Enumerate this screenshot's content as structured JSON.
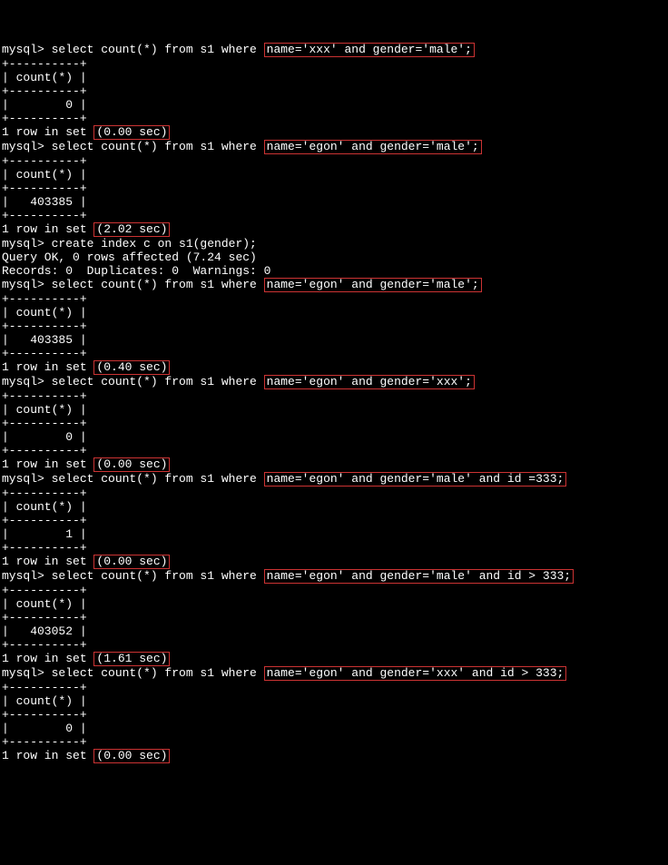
{
  "prompt": "mysql> ",
  "sep": "+----------+",
  "hdr": "| count(*) |",
  "rowfmt": "1 row in set ",
  "q1": {
    "pre": "select count(*) from s1 where ",
    "cond": "name='xxx' and gender='male';",
    "val": "|        0 |",
    "time": "(0.00 sec)"
  },
  "q2": {
    "pre": "select count(*) from s1 where ",
    "cond": "name='egon' and gender='male';",
    "val": "|   403385 |",
    "time": "(2.02 sec)"
  },
  "idx": {
    "cmd": "create index c on s1(gender);",
    "ok": "Query OK, 0 rows affected (7.24 sec)",
    "rec": "Records: 0  Duplicates: 0  Warnings: 0"
  },
  "q3": {
    "pre": "select count(*) from s1 where ",
    "cond": "name='egon' and gender='male';",
    "val": "|   403385 |",
    "time": "(0.40 sec)"
  },
  "q4": {
    "pre": "select count(*) from s1 where ",
    "cond": "name='egon' and gender='xxx';",
    "val": "|        0 |",
    "time": "(0.00 sec)"
  },
  "q5": {
    "pre": "select count(*) from s1 where ",
    "cond": "name='egon' and gender='male' and id =333;",
    "val": "|        1 |",
    "time": "(0.00 sec)"
  },
  "q6": {
    "pre": "select count(*) from s1 where ",
    "cond": "name='egon' and gender='male' and id > 333;",
    "val": "|   403052 |",
    "time": "(1.61 sec)"
  },
  "q7": {
    "pre": "select count(*) from s1 where ",
    "cond": "name='egon' and gender='xxx' and id > 333;",
    "val": "|        0 |",
    "time": "(0.00 sec)"
  }
}
